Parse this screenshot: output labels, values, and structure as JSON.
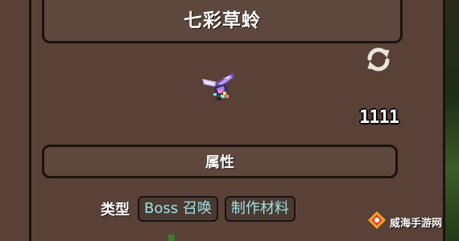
{
  "item": {
    "name": "七彩草蛉",
    "stack_count": "1111",
    "refresh_icon": "refresh-icon",
    "sprite_icon": "prismatic-lacewing-sprite"
  },
  "attributes": {
    "header": "属性",
    "type_label": "类型",
    "tags": [
      "Boss 召唤",
      "制作材料"
    ]
  },
  "watermark": {
    "text": "威海手游网",
    "logo_icon": "logo-icon"
  },
  "colors": {
    "panel": "#594137",
    "border": "#1a120e",
    "tag_text": "#9fe0e7"
  }
}
